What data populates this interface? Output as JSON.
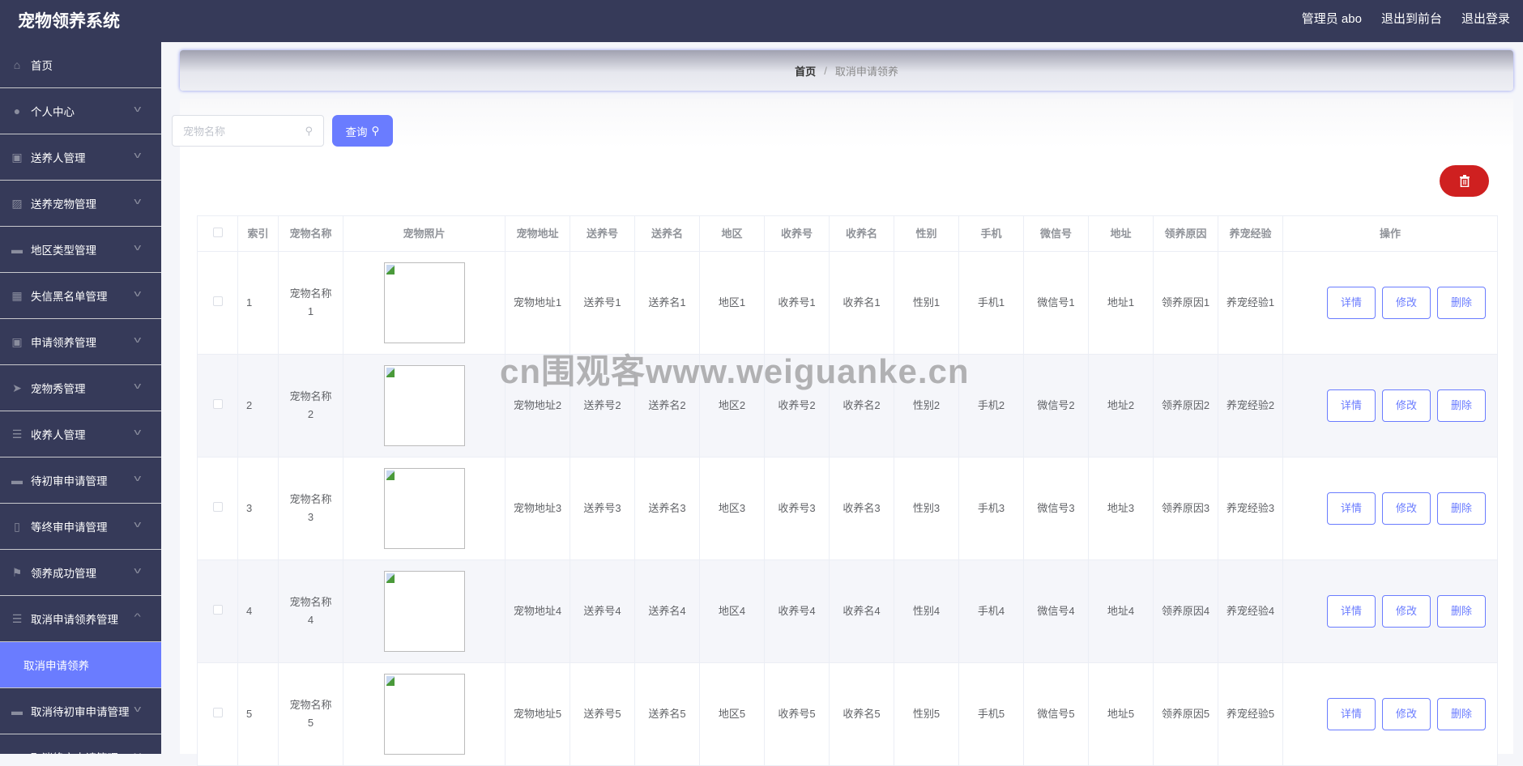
{
  "header": {
    "title": "宠物领养系统",
    "user": "管理员 abo",
    "to_front": "退出到前台",
    "logout": "退出登录"
  },
  "sidebar": {
    "items": [
      {
        "label": "首页",
        "icon": "home-icon"
      },
      {
        "label": "个人中心",
        "icon": "user-icon"
      },
      {
        "label": "送养人管理",
        "icon": "clipboard-x-icon"
      },
      {
        "label": "送养宠物管理",
        "icon": "chart-icon"
      },
      {
        "label": "地区类型管理",
        "icon": "ticket-icon"
      },
      {
        "label": "失信黑名单管理",
        "icon": "grid-icon"
      },
      {
        "label": "申请领养管理",
        "icon": "clipboard-check-icon"
      },
      {
        "label": "宠物秀管理",
        "icon": "send-icon"
      },
      {
        "label": "收养人管理",
        "icon": "list-icon"
      },
      {
        "label": "待初审申请管理",
        "icon": "printer-icon"
      },
      {
        "label": "等终审申请管理",
        "icon": "microphone-icon"
      },
      {
        "label": "领养成功管理",
        "icon": "flag-icon"
      },
      {
        "label": "取消申请领养管理",
        "icon": "sliders-icon"
      },
      {
        "label": "取消待初审申请管理",
        "icon": "briefcase-icon"
      },
      {
        "label": "取消终审申请管理",
        "icon": "slash-circle-icon"
      }
    ],
    "active_sub": "取消申请领养"
  },
  "breadcrumb": {
    "home": "首页",
    "separator": "/",
    "current": "取消申请领养"
  },
  "search": {
    "placeholder": "宠物名称",
    "value": "",
    "button": "查询"
  },
  "table": {
    "headers": [
      "索引",
      "宠物名称",
      "宠物照片",
      "宠物地址",
      "送养号",
      "送养名",
      "地区",
      "收养号",
      "收养名",
      "性别",
      "手机",
      "微信号",
      "地址",
      "领养原因",
      "养宠经验",
      "操作"
    ],
    "rows": [
      [
        "1",
        "宠物名称1",
        "宠物地址1",
        "送养号1",
        "送养名1",
        "地区1",
        "收养号1",
        "收养名1",
        "性别1",
        "手机1",
        "微信号1",
        "地址1",
        "领养原因1",
        "养宠经验1"
      ],
      [
        "2",
        "宠物名称2",
        "宠物地址2",
        "送养号2",
        "送养名2",
        "地区2",
        "收养号2",
        "收养名2",
        "性别2",
        "手机2",
        "微信号2",
        "地址2",
        "领养原因2",
        "养宠经验2"
      ],
      [
        "3",
        "宠物名称3",
        "宠物地址3",
        "送养号3",
        "送养名3",
        "地区3",
        "收养号3",
        "收养名3",
        "性别3",
        "手机3",
        "微信号3",
        "地址3",
        "领养原因3",
        "养宠经验3"
      ],
      [
        "4",
        "宠物名称4",
        "宠物地址4",
        "送养号4",
        "送养名4",
        "地区4",
        "收养号4",
        "收养名4",
        "性别4",
        "手机4",
        "微信号4",
        "地址4",
        "领养原因4",
        "养宠经验4"
      ],
      [
        "5",
        "宠物名称5",
        "宠物地址5",
        "送养号5",
        "送养名5",
        "地区5",
        "收养号5",
        "收养名5",
        "性别5",
        "手机5",
        "微信号5",
        "地址5",
        "领养原因5",
        "养宠经验5"
      ]
    ],
    "actions": {
      "detail": "详情",
      "edit": "修改",
      "delete": "删除"
    }
  },
  "watermark": "cn围观客www.weiguanke.cn",
  "colors": {
    "header": "#363a59",
    "accent": "#6a7cff",
    "danger": "#cf2020"
  }
}
